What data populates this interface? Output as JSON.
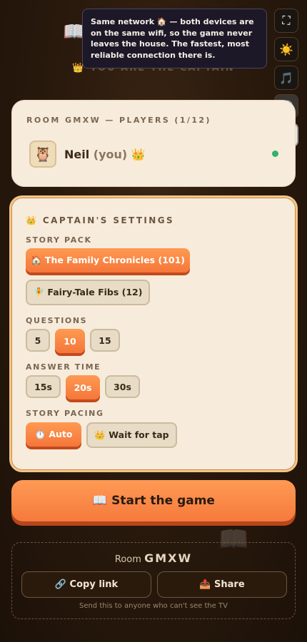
{
  "header": {
    "book_icon": "📖",
    "captain_line": "👑 YOU ARE THE CAPTAIN"
  },
  "tooltip": {
    "text": "Same network 🏠 — both devices are on the same wifi, so the game never leaves the house. The fastest, most reliable connection there is."
  },
  "side_buttons": [
    {
      "name": "fullscreen-icon",
      "glyph": "⛶"
    },
    {
      "name": "brightness-icon",
      "glyph": "☀️"
    },
    {
      "name": "music-icon",
      "glyph": "🎵"
    },
    {
      "name": "speaker-icon",
      "glyph": "🔊"
    },
    {
      "name": "home-network-icon",
      "glyph": "🏠"
    }
  ],
  "players": {
    "title": "ROOM GMXW — PLAYERS (1/12)",
    "list": [
      {
        "avatar": "🦉",
        "name": "Neil",
        "you": "(you)",
        "crown": "👑",
        "status_color": "#2fb36a"
      }
    ]
  },
  "settings": {
    "title": "👑 CAPTAIN'S SETTINGS",
    "story_pack_label": "STORY PACK",
    "story_packs": [
      {
        "label": "🏠 The Family Chronicles (101)",
        "selected": true
      },
      {
        "label": "🧚 Fairy-Tale Fibs (12)",
        "selected": false
      }
    ],
    "questions_label": "QUESTIONS",
    "questions": [
      {
        "label": "5",
        "selected": false
      },
      {
        "label": "10",
        "selected": true
      },
      {
        "label": "15",
        "selected": false
      }
    ],
    "answer_time_label": "ANSWER TIME",
    "answer_times": [
      {
        "label": "15s",
        "selected": false
      },
      {
        "label": "20s",
        "selected": true
      },
      {
        "label": "30s",
        "selected": false
      }
    ],
    "pacing_label": "STORY PACING",
    "pacing": [
      {
        "label": "⏱️ Auto",
        "selected": true
      },
      {
        "label": "👑 Wait for tap",
        "selected": false
      }
    ]
  },
  "start_button": {
    "label": "📖 Start the game"
  },
  "share": {
    "room_prefix": "Room",
    "room_code": "GMXW",
    "copy_label": "🔗 Copy link",
    "share_label": "📤 Share",
    "hint": "Send this to anyone who can't see the TV"
  },
  "colors": {
    "accent": "#f5793a",
    "card": "#f7ecdb",
    "background": "#2a1a0d"
  }
}
